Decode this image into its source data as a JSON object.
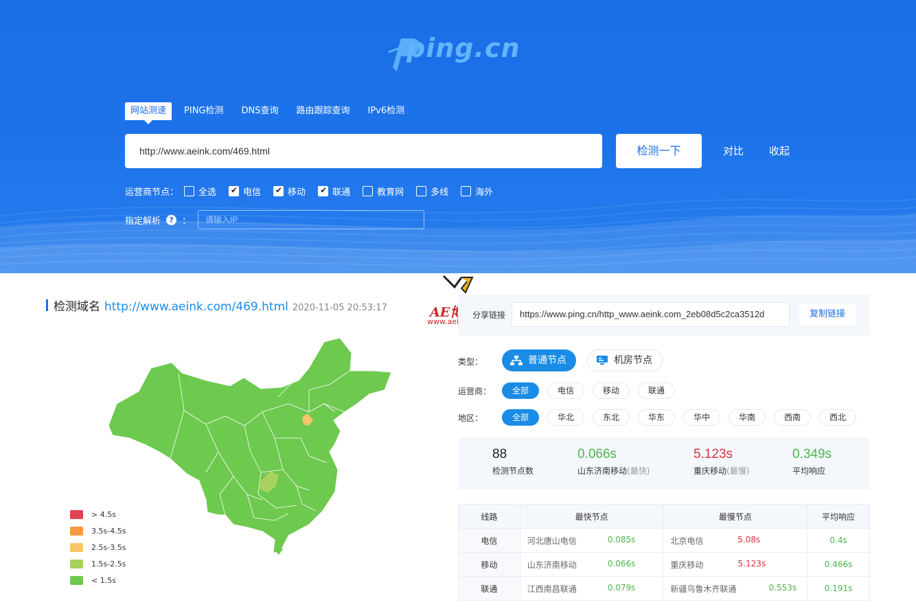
{
  "header": {
    "logo_text": "ping.cn",
    "tabs": [
      {
        "label": "网站测速",
        "active": true
      },
      {
        "label": "PING检测",
        "active": false
      },
      {
        "label": "DNS查询",
        "active": false
      },
      {
        "label": "路由跟踪查询",
        "active": false
      },
      {
        "label": "IPv6检测",
        "active": false
      }
    ],
    "url_value": "http://www.aeink.com/469.html",
    "check_button": "检测一下",
    "compare_link": "对比",
    "collapse_link": "收起",
    "isp_label": "运营商节点：",
    "isp_options": [
      {
        "label": "全选",
        "checked": false
      },
      {
        "label": "电信",
        "checked": true
      },
      {
        "label": "移动",
        "checked": true
      },
      {
        "label": "联通",
        "checked": true
      },
      {
        "label": "教育网",
        "checked": false
      },
      {
        "label": "多线",
        "checked": false
      },
      {
        "label": "海外",
        "checked": false
      }
    ],
    "resolve_label": "指定解析",
    "resolve_colon": "：",
    "ip_placeholder": "请输入IP"
  },
  "watermark": {
    "brand": "AE博客",
    "url": "www.aeink.com"
  },
  "result": {
    "title_prefix": "检测域名",
    "domain": "http://www.aeink.com/469.html",
    "timestamp": "2020-11-05 20:53:17"
  },
  "legend": [
    {
      "label": "> 4.5s",
      "color": "#e0434f"
    },
    {
      "label": "3.5s-4.5s",
      "color": "#f59a45"
    },
    {
      "label": "2.5s-3.5s",
      "color": "#f8c56a"
    },
    {
      "label": "1.5s-2.5s",
      "color": "#a8d15d"
    },
    {
      "label": "< 1.5s",
      "color": "#6ec94f"
    }
  ],
  "share": {
    "label": "分享链接",
    "value": "https://www.ping.cn/http_www.aeink.com_2eb08d5c2ca3512d",
    "copy_button": "复制链接"
  },
  "filters": {
    "type_label": "类型：",
    "type_options": [
      "普通节点",
      "机房节点"
    ],
    "isp_label": "运营商：",
    "isp_options": [
      "全部",
      "电信",
      "移动",
      "联通"
    ],
    "region_label": "地区：",
    "region_options": [
      "全部",
      "华北",
      "东北",
      "华东",
      "华中",
      "华南",
      "西南",
      "西北"
    ]
  },
  "stats": {
    "node_count": "88",
    "node_count_label": "检测节点数",
    "fastest_value": "0.066s",
    "fastest_label": "山东济南移动",
    "fastest_tag": "(最快)",
    "slowest_value": "5.123s",
    "slowest_label": "重庆移动",
    "slowest_tag": "(最慢)",
    "avg_value": "0.349s",
    "avg_label": "平均响应"
  },
  "table": {
    "headers": [
      "线路",
      "最快节点",
      "最慢节点",
      "平均响应"
    ],
    "rows": [
      {
        "line": "电信",
        "fast_node": "河北唐山电信",
        "fast_time": "0.085s",
        "slow_node": "北京电信",
        "slow_time": "5.08s",
        "avg": "0.4s"
      },
      {
        "line": "移动",
        "fast_node": "山东济南移动",
        "fast_time": "0.066s",
        "slow_node": "重庆移动",
        "slow_time": "5.123s",
        "avg": "0.466s"
      },
      {
        "line": "联通",
        "fast_node": "江西南昌联通",
        "fast_time": "0.079s",
        "slow_node": "新疆乌鲁木齐联通",
        "slow_time": "0.553s",
        "avg": "0.191s"
      }
    ]
  },
  "colors": {
    "brand_blue": "#1a6ee6",
    "accent_blue": "#1a8ce6",
    "fast_green": "#4cb64c",
    "slow_red": "#d9343a",
    "map_green": "#6ec94f"
  }
}
